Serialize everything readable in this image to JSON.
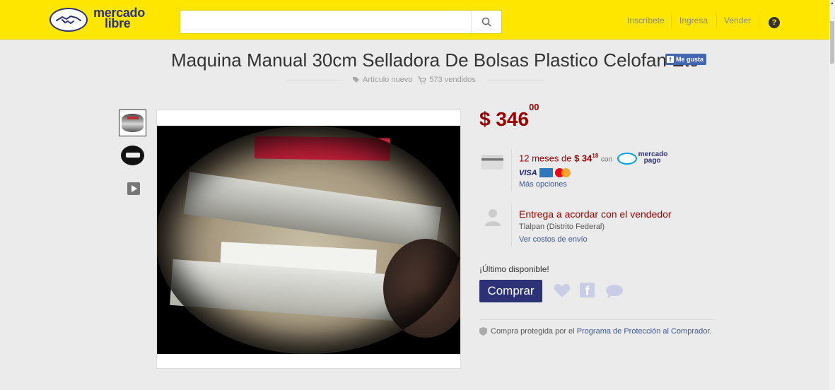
{
  "header": {
    "logo_line1": "mercado",
    "logo_line2": "libre",
    "search_placeholder": "",
    "nav": [
      "Inscríbete",
      "Ingresa",
      "Vender"
    ],
    "help": "?"
  },
  "product": {
    "title": "Maquina Manual 30cm Selladora De Bolsas Plastico Celofan Etc",
    "like_label": "Me gusta",
    "condition": "Artículo nuevo",
    "sold": "573 vendidos",
    "price_whole": "$ 346",
    "price_cents": "00"
  },
  "payment": {
    "installments_prefix": "12 meses de",
    "installment_amount": "$ 34",
    "installment_cents": "18",
    "with": "con",
    "mp_line1": "mercado",
    "mp_line2": "pago",
    "visa": "VISA",
    "more_options": "Más opciones"
  },
  "shipping": {
    "title": "Entrega a acordar con el vendedor",
    "location": "Tlalpan (Distrito Federal)",
    "costs_link": "Ver costos de envío"
  },
  "buy": {
    "stock": "¡Último disponible!",
    "button": "Comprar"
  },
  "protection": {
    "text": "Compra protegida por el",
    "link": "Programa de Protección al Comprador",
    "end": "."
  },
  "colors": {
    "brand_yellow": "#ffe600",
    "brand_blue": "#2d3277",
    "price_red": "#990000"
  }
}
